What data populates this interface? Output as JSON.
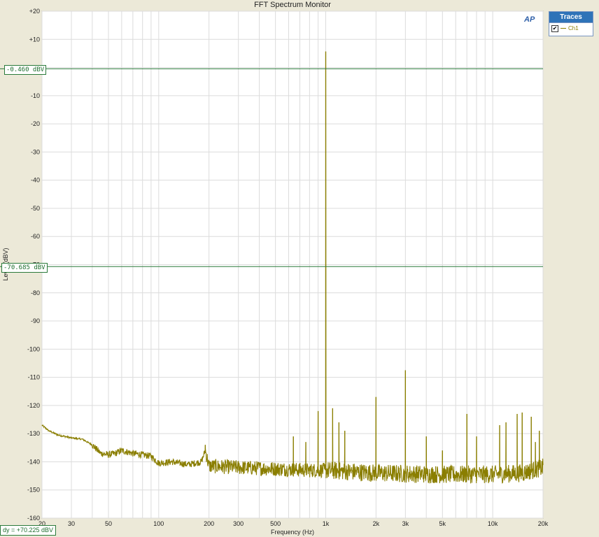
{
  "window": {
    "title": "FFT Spectrum Monitor"
  },
  "traces_panel": {
    "header": "Traces",
    "items": [
      {
        "label": "Ch1",
        "checked": true,
        "check_glyph": "✔",
        "color": "#8a7e00"
      }
    ]
  },
  "logo": {
    "text": "AP",
    "icon": "ap-logo-icon"
  },
  "cursors": {
    "upper": "-0.460 dBV",
    "lower": "-70.685 dBV",
    "delta": "dy = +70.225 dBV",
    "color": "#2a7a3a"
  },
  "chart_data": {
    "type": "line",
    "title": "FFT Spectrum Monitor",
    "xlabel": "Frequency (Hz)",
    "ylabel": "Level (dBV)",
    "xscale": "log",
    "xlim": [
      20,
      20000
    ],
    "ylim": [
      -160,
      20
    ],
    "grid": true,
    "legend": "right panel",
    "x_ticks": [
      {
        "value": 20,
        "label": "20"
      },
      {
        "value": 30,
        "label": "30"
      },
      {
        "value": 50,
        "label": "50"
      },
      {
        "value": 100,
        "label": "100"
      },
      {
        "value": 200,
        "label": "200"
      },
      {
        "value": 300,
        "label": "300"
      },
      {
        "value": 500,
        "label": "500"
      },
      {
        "value": 1000,
        "label": "1k"
      },
      {
        "value": 2000,
        "label": "2k"
      },
      {
        "value": 3000,
        "label": "3k"
      },
      {
        "value": 5000,
        "label": "5k"
      },
      {
        "value": 10000,
        "label": "10k"
      },
      {
        "value": 20000,
        "label": "20k"
      }
    ],
    "y_ticks": [
      {
        "value": 20,
        "label": "+20"
      },
      {
        "value": 10,
        "label": "+10"
      },
      {
        "value": 0,
        "label": "0"
      },
      {
        "value": -10,
        "label": "-10"
      },
      {
        "value": -20,
        "label": "-20"
      },
      {
        "value": -30,
        "label": "-30"
      },
      {
        "value": -40,
        "label": "-40"
      },
      {
        "value": -50,
        "label": "-50"
      },
      {
        "value": -60,
        "label": "-60"
      },
      {
        "value": -70,
        "label": "-70"
      },
      {
        "value": -80,
        "label": "-80"
      },
      {
        "value": -90,
        "label": "-90"
      },
      {
        "value": -100,
        "label": "-100"
      },
      {
        "value": -110,
        "label": "-110"
      },
      {
        "value": -120,
        "label": "-120"
      },
      {
        "value": -130,
        "label": "-130"
      },
      {
        "value": -140,
        "label": "-140"
      },
      {
        "value": -150,
        "label": "-150"
      },
      {
        "value": -160,
        "label": "-160"
      }
    ],
    "cursor_levels": [
      -0.46,
      -70.685
    ],
    "series": [
      {
        "name": "Ch1",
        "color": "#8a7e00",
        "baseline": [
          [
            20,
            -127
          ],
          [
            22,
            -129
          ],
          [
            25,
            -130.5
          ],
          [
            30,
            -131.5
          ],
          [
            35,
            -132
          ],
          [
            40,
            -134
          ],
          [
            45,
            -137
          ],
          [
            50,
            -137.5
          ],
          [
            55,
            -137
          ],
          [
            60,
            -136
          ],
          [
            70,
            -137
          ],
          [
            80,
            -137.5
          ],
          [
            90,
            -138
          ],
          [
            100,
            -140.5
          ],
          [
            120,
            -140
          ],
          [
            150,
            -141
          ],
          [
            180,
            -140
          ],
          [
            190,
            -136
          ],
          [
            200,
            -141.5
          ],
          [
            300,
            -142
          ],
          [
            500,
            -142.5
          ],
          [
            800,
            -143
          ],
          [
            1000,
            -143
          ],
          [
            2000,
            -144
          ],
          [
            5000,
            -144.5
          ],
          [
            10000,
            -144.5
          ],
          [
            15000,
            -144
          ],
          [
            20000,
            -142
          ]
        ],
        "peaks": [
          [
            190,
            -134
          ],
          [
            640,
            -131
          ],
          [
            760,
            -133
          ],
          [
            900,
            -122
          ],
          [
            1000,
            5.7
          ],
          [
            1100,
            -121
          ],
          [
            1200,
            -126
          ],
          [
            1300,
            -129
          ],
          [
            2000,
            -117
          ],
          [
            3000,
            -107.5
          ],
          [
            4000,
            -131
          ],
          [
            5000,
            -136
          ],
          [
            7000,
            -123
          ],
          [
            8000,
            -131
          ],
          [
            11000,
            -127
          ],
          [
            12000,
            -126
          ],
          [
            14000,
            -123
          ],
          [
            15000,
            -122.5
          ],
          [
            17000,
            -124
          ],
          [
            18000,
            -133
          ],
          [
            19000,
            -129
          ]
        ]
      }
    ]
  }
}
